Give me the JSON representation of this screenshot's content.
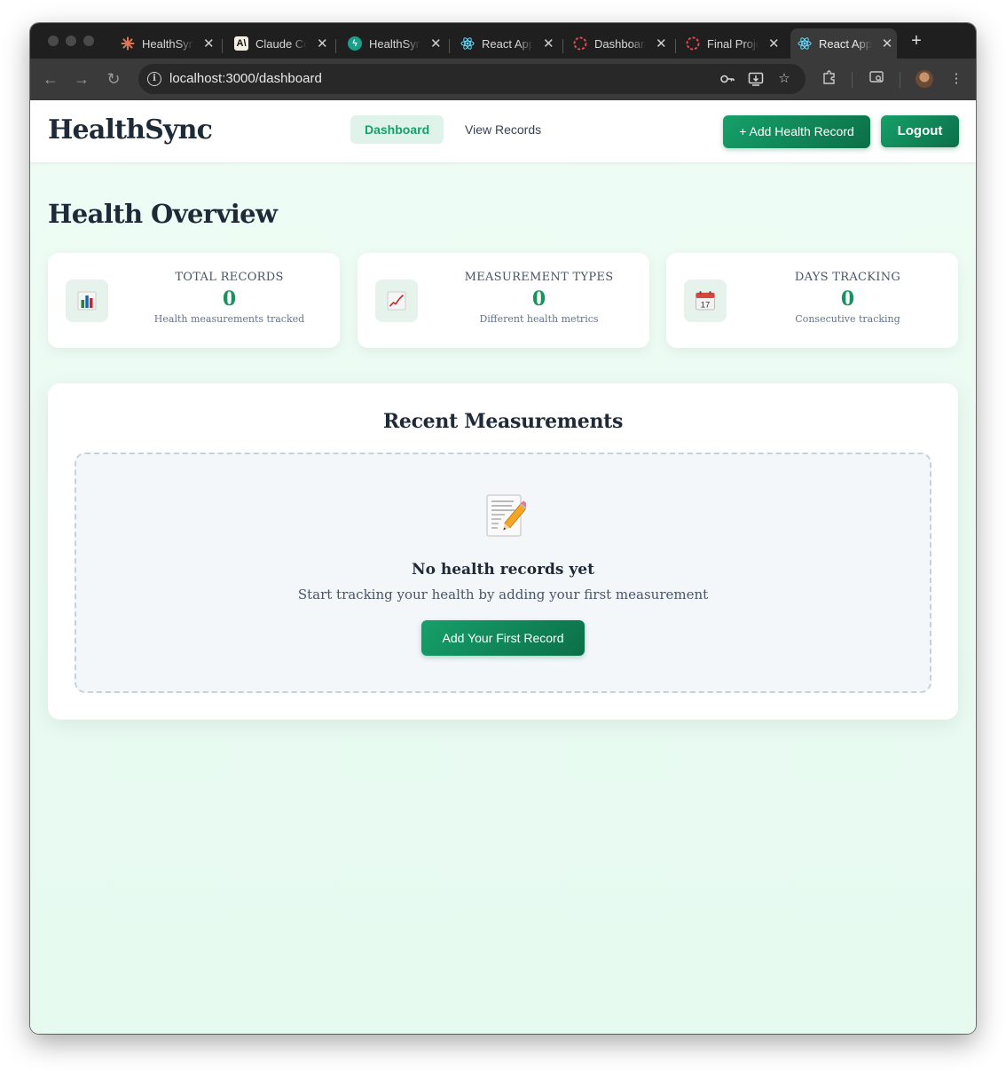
{
  "browser": {
    "tabs": [
      {
        "title": "HealthSync",
        "icon": "claude-asterisk-icon"
      },
      {
        "title": "Claude Code",
        "icon": "anthropic-icon"
      },
      {
        "title": "HealthSync",
        "icon": "bolt-icon"
      },
      {
        "title": "React App",
        "icon": "react-icon"
      },
      {
        "title": "Dashboard",
        "icon": "dashed-circle-icon"
      },
      {
        "title": "Final Project",
        "icon": "dashed-circle-icon"
      },
      {
        "title": "React App",
        "icon": "react-icon",
        "active": true
      }
    ],
    "url": "localhost:3000/dashboard",
    "colors": {
      "tabstrip": "#1f1f1f",
      "toolbar": "#3a3a3a",
      "omnibox": "#282828"
    }
  },
  "header": {
    "brand": "HealthSync",
    "nav": {
      "dashboard": "Dashboard",
      "view_records": "View Records"
    },
    "add_button": "+ Add Health Record",
    "logout_button": "Logout"
  },
  "main": {
    "title": "Health Overview",
    "stats": [
      {
        "label": "TOTAL RECORDS",
        "value": "0",
        "sub": "Health measurements tracked",
        "icon": "bar-chart-icon"
      },
      {
        "label": "MEASUREMENT TYPES",
        "value": "0",
        "sub": "Different health metrics",
        "icon": "line-chart-icon"
      },
      {
        "label": "DAYS TRACKING",
        "value": "0",
        "sub": "Consecutive tracking",
        "icon": "calendar-icon",
        "calendar_day": "17"
      }
    ],
    "recent": {
      "title": "Recent Measurements",
      "empty_title": "No health records yet",
      "empty_sub": "Start tracking your health by adding your first measurement",
      "cta": "Add Your First Record",
      "icon": "memo-pencil-icon"
    }
  },
  "colors": {
    "accent": "#16a06a",
    "accent_dark": "#0c6f48",
    "value": "#16935f",
    "page_bg": "#e6faf0",
    "text_dark": "#1e2a38"
  }
}
